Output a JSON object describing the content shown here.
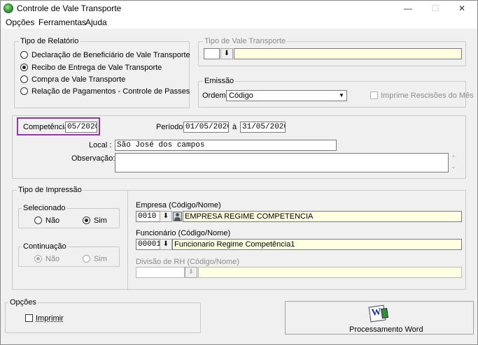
{
  "window": {
    "title": "Controle de Vale Transporte",
    "minimize": "—",
    "maximize": "☐",
    "close": "✕"
  },
  "menu": [
    "Opções",
    "Ferramentas",
    "Ajuda"
  ],
  "tipo_relatorio": {
    "legend": "Tipo de Relatório",
    "options": [
      "Declaração de Beneficiário de Vale Transporte",
      "Recibo de Entrega de Vale Transporte",
      "Compra de Vale Transporte",
      "Relação de Pagamentos - Controle de Passes"
    ],
    "selected_index": 1
  },
  "tipo_vale": {
    "legend": "Tipo de Vale Transporte",
    "code_value": "",
    "name_value": ""
  },
  "emissao": {
    "legend": "Emissão",
    "ordem_label": "Ordem:",
    "ordem_value": "Código",
    "imprime_rescisoes_label": "Imprime Rescisões do Mês"
  },
  "periodo": {
    "competencia_label": "Competência:",
    "competencia_value": "05/2020",
    "periodo_label": "Período:",
    "inicio": "01/05/2020",
    "a_label": "à",
    "fim": "31/05/2020",
    "local_label": "Local :",
    "local_value": "São José dos campos",
    "observacao_label": "Observação:",
    "observacao_value": ""
  },
  "tipo_impressao": {
    "legend": "Tipo de Impressão",
    "selecionado": {
      "legend": "Selecionado",
      "nao": "Não",
      "sim": "Sim",
      "selected": "sim"
    },
    "continuacao": {
      "legend": "Continuação",
      "nao": "Não",
      "sim": "Sim",
      "selected": "nao"
    },
    "empresa_label": "Empresa (Código/Nome)",
    "empresa_code": "0010",
    "empresa_name": "EMPRESA REGIME COMPETENCIA",
    "funcionario_label": "Funcionário (Código/Nome)",
    "funcionario_code": "00001",
    "funcionario_name": "Funcionario Regime Competência1",
    "divisao_label": "Divisão de RH (Código/Nome)",
    "divisao_code": "",
    "divisao_name": ""
  },
  "opcoes": {
    "legend": "Opções",
    "imprimir_label": "Imprimir"
  },
  "processamento": {
    "label": "Processamento Word"
  },
  "icons": {
    "dropdown_arrow": "⬇",
    "combo_arrow": "▼",
    "scroll_up": "⌃",
    "scroll_down": "⌄"
  }
}
